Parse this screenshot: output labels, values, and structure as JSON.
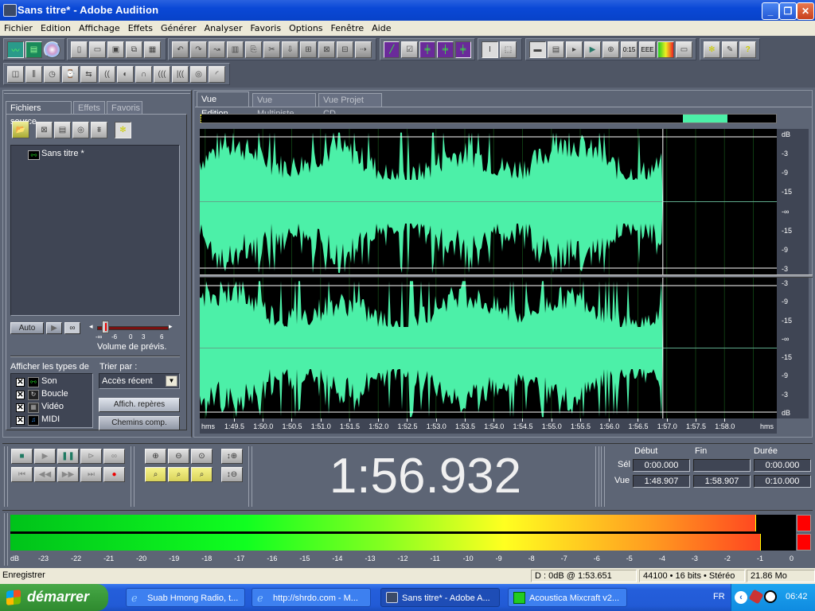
{
  "window": {
    "title": "Sans titre* - Adobe Audition"
  },
  "menu": [
    "Fichier",
    "Edition",
    "Affichage",
    "Effets",
    "Générer",
    "Analyser",
    "Favoris",
    "Options",
    "Fenêtre",
    "Aide"
  ],
  "toolbar": {
    "row1_groups": [
      [
        "edit-view-icon",
        "multitrack-view-icon",
        "cd-view-icon"
      ],
      [
        "new-file-icon",
        "open-file-icon",
        "save-icon",
        "save-all-icon",
        "close-file-icon"
      ],
      [
        "undo-icon",
        "redo-icon",
        "repeat-last-icon",
        "copy-to-new-icon",
        "copy-icon",
        "cut-icon",
        "paste-icon",
        "paste-mix-icon",
        "trim-icon",
        "mute-icon",
        "find-beats-icon"
      ],
      [
        "spectral-view-icon",
        "sample-type-icon",
        "show-cue-icon",
        "show-ranges-icon",
        "snap-icon"
      ],
      [
        "time-selection-icon",
        "marquee-icon"
      ],
      [
        "window-organizer-icon",
        "cue-list-icon",
        "playlist-icon",
        "transport-icon",
        "zoom-window-icon",
        "time-window-icon",
        "selection-window-icon",
        "level-meter-icon",
        "status-bar-icon"
      ],
      [
        "settings-icon",
        "scripts-icon",
        "help-icon"
      ]
    ],
    "row1_texts": {
      "time": "0:15"
    },
    "row2": [
      "amplitude-icon",
      "envelope-icon",
      "stretch-icon",
      "time-pitch-icon",
      "delay-icon",
      "reverb-icon",
      "filter-icon",
      "eq-icon",
      "noise-icon",
      "echo-icon",
      "chorus-icon",
      "fade-icon"
    ]
  },
  "left_panel": {
    "tabs": [
      "Fichiers source",
      "Effets",
      "Favoris"
    ],
    "active_tab": 0,
    "files": [
      {
        "name": "Sans titre *",
        "icon": "waveform-file-icon"
      }
    ],
    "auto_label": "Auto",
    "volume_label": "Volume de prévis.",
    "volume_ticks": [
      "-∞",
      "-6",
      "0",
      "3",
      "6"
    ],
    "volume_value_db": -6,
    "filter_title": "Afficher les types de",
    "file_types": [
      {
        "label": "Son",
        "checked": true,
        "icon": "sound-icon"
      },
      {
        "label": "Boucle",
        "checked": true,
        "icon": "loop-icon"
      },
      {
        "label": "Vidéo",
        "checked": true,
        "icon": "video-icon"
      },
      {
        "label": "MIDI",
        "checked": true,
        "icon": "midi-icon"
      }
    ],
    "sort_label": "Trier par :",
    "sort_value": "Accès récent",
    "markers_button": "Affich. repères",
    "paths_button": "Chemins comp."
  },
  "main": {
    "tabs": [
      "Vue Edition",
      "Vue Multipiste",
      "Vue Projet CD"
    ],
    "active_tab": 0,
    "overview_view_fraction": [
      0.838,
      0.915
    ],
    "db_labels_top": [
      "dB",
      "-3",
      "-9",
      "-15",
      "-∞",
      "-15",
      "-9",
      "-3"
    ],
    "db_labels_bottom": [
      "-3",
      "-9",
      "-15",
      "-∞",
      "-15",
      "-9",
      "-3",
      "dB"
    ],
    "timeline_unit": "hms",
    "timeline_labels": [
      "1:49.5",
      "1:50.0",
      "1:50.5",
      "1:51.0",
      "1:51.5",
      "1:52.0",
      "1:52.5",
      "1:53.0",
      "1:53.5",
      "1:54.0",
      "1:54.5",
      "1:55.0",
      "1:55.5",
      "1:56.0",
      "1:56.5",
      "1:57.0",
      "1:57.5",
      "1:58.0"
    ],
    "view_start_s": 108.907,
    "view_end_s": 118.907,
    "audio_end_s": 116.93,
    "cursor_s": 116.932,
    "waveform_color": "#4cf0a8"
  },
  "transport": {
    "buttons_row1": [
      "stop-icon",
      "play-icon",
      "pause-icon",
      "play-from-cursor-icon",
      "loop-icon"
    ],
    "buttons_row2": [
      "go-start-icon",
      "rewind-icon",
      "fast-forward-icon",
      "go-end-icon",
      "record-icon"
    ]
  },
  "zoom": {
    "row1": [
      "zoom-in-icon",
      "zoom-out-icon",
      "zoom-full-icon",
      "zoom-in-vertical-icon"
    ],
    "row2": [
      "zoom-selection-left-icon",
      "zoom-selection-icon",
      "zoom-selection-right-icon",
      "zoom-out-vertical-icon"
    ]
  },
  "time_display": "1:56.932",
  "selection": {
    "headers": [
      "Début",
      "Fin",
      "Durée"
    ],
    "rows": [
      {
        "label": "Sél",
        "values": [
          "0:00.000",
          "",
          "0:00.000"
        ]
      },
      {
        "label": "Vue",
        "values": [
          "1:48.907",
          "1:58.907",
          "0:10.000"
        ]
      }
    ]
  },
  "meter": {
    "ticks": [
      "dB",
      "-23",
      "-22",
      "-21",
      "-20",
      "-19",
      "-18",
      "-17",
      "-16",
      "-15",
      "-14",
      "-13",
      "-12",
      "-11",
      "-10",
      "-9",
      "-8",
      "-7",
      "-6",
      "-5",
      "-4",
      "-3",
      "-2",
      "-1",
      "0"
    ],
    "left_level_db": -1.2,
    "right_level_db": -1.05,
    "clip_left": true,
    "clip_right": true
  },
  "status": {
    "left": "Enregistrer",
    "peak": "D : 0dB @  1:53.651",
    "format": "44100 • 16 bits • Stéréo",
    "size": "21.86 Mo"
  },
  "taskbar": {
    "start_label": "démarrer",
    "tasks": [
      {
        "label": "Suab Hmong Radio, t...",
        "icon": "ie-icon",
        "active": false
      },
      {
        "label": "http://shrdo.com - M...",
        "icon": "ie-icon",
        "active": false
      },
      {
        "label": "Sans titre* - Adobe A...",
        "icon": "audition-icon",
        "active": true
      },
      {
        "label": "Acoustica Mixcraft v2...",
        "icon": "mixcraft-icon",
        "active": false
      }
    ],
    "lang": "FR",
    "clock": "06:42"
  }
}
